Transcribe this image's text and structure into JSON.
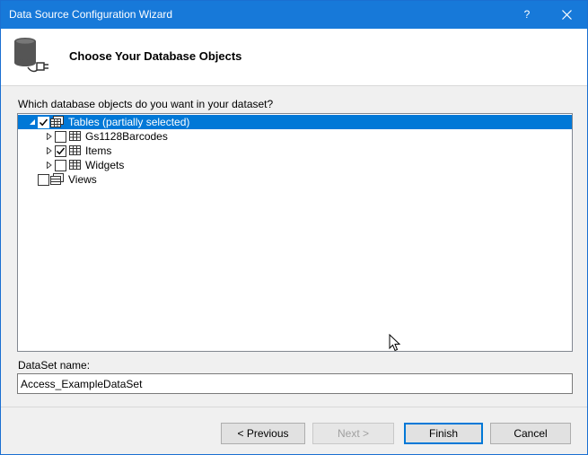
{
  "window": {
    "title": "Data Source Configuration Wizard",
    "help_label": "?",
    "accent_color": "#1779d9"
  },
  "header": {
    "title": "Choose Your Database Objects",
    "icon": "database-plug-icon"
  },
  "tree": {
    "question": "Which database objects do you want in your dataset?",
    "root": {
      "label": "Tables (partially selected)",
      "expanded": true,
      "checked": "partial",
      "selected": true,
      "icon": "tables-icon"
    },
    "tables": [
      {
        "label": "Gs1128Barcodes",
        "checked": false,
        "icon": "table-icon"
      },
      {
        "label": "Items",
        "checked": true,
        "icon": "table-icon"
      },
      {
        "label": "Widgets",
        "checked": false,
        "icon": "table-icon"
      }
    ],
    "views": {
      "label": "Views",
      "checked": false,
      "icon": "views-icon"
    }
  },
  "dataset": {
    "label": "DataSet name:",
    "value": "Access_ExampleDataSet"
  },
  "buttons": {
    "previous": "< Previous",
    "next": "Next >",
    "finish": "Finish",
    "cancel": "Cancel"
  }
}
